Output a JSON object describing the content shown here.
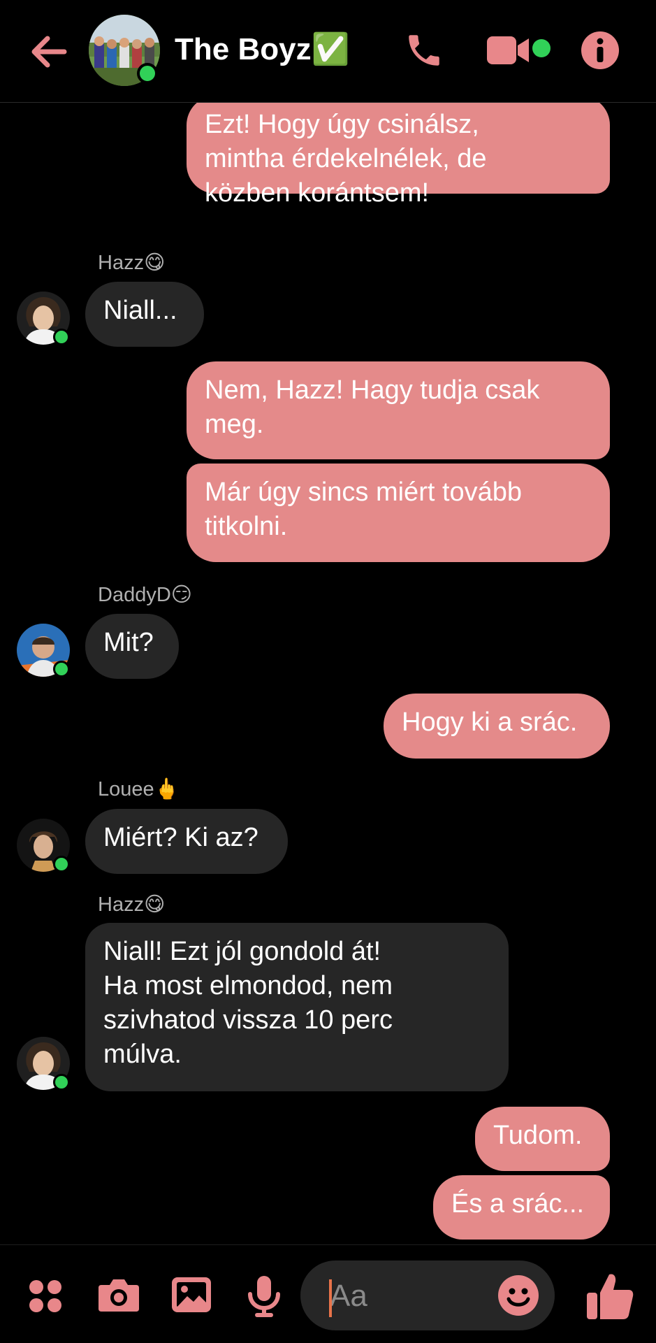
{
  "header": {
    "title": "The Boyz✅",
    "icons": [
      "back-arrow-icon",
      "phone-icon",
      "video-camera-icon",
      "info-icon"
    ]
  },
  "messages": [
    {
      "direction": "out",
      "text": "Ezt! Hogy úgy csinálsz,\nmintha érdekelnélek, de\nközben korántsem!"
    },
    {
      "direction": "in",
      "sender": "Hazz😋",
      "text": "Niall..."
    },
    {
      "direction": "out",
      "text": "Nem, Hazz! Hagy tudja csak\nmeg."
    },
    {
      "direction": "out",
      "text": "Már úgy sincs miért tovább\ntitkolni."
    },
    {
      "direction": "in",
      "sender": "DaddyD😏",
      "text": "Mit?"
    },
    {
      "direction": "out",
      "text": "Hogy ki a srác."
    },
    {
      "direction": "in",
      "sender": "Louee🖕",
      "text": "Miért? Ki az?"
    },
    {
      "direction": "in",
      "sender": "Hazz😋",
      "text": "Niall! Ezt jól gondold át!\nHa most elmondod, nem\nszivhatod vissza 10 perc\nmúlva."
    },
    {
      "direction": "out",
      "text": "Tudom."
    },
    {
      "direction": "out",
      "text": "És a srác..."
    }
  ],
  "composer": {
    "placeholder": "Aa",
    "icons": [
      "apps-grid-icon",
      "camera-icon",
      "image-icon",
      "microphone-icon",
      "emoji-icon",
      "thumbs-up-icon"
    ]
  },
  "colors": {
    "accent": "#e48a8a",
    "icon": "#e8878a",
    "incoming_bubble": "#262626",
    "online": "#31d158",
    "background": "#000000"
  }
}
